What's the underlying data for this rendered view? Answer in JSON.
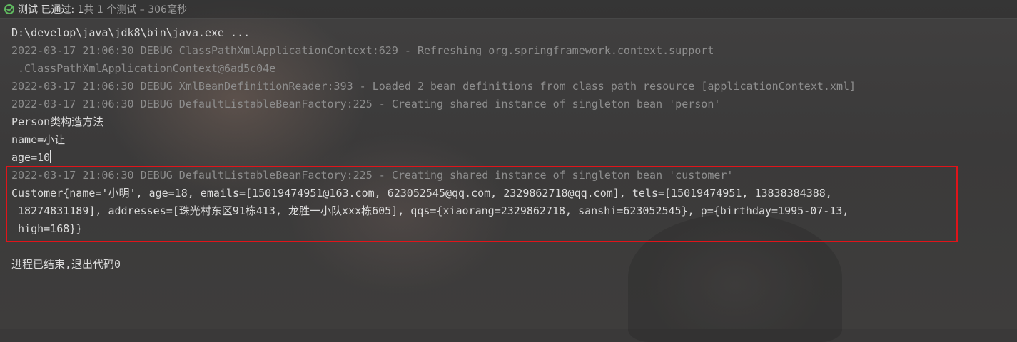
{
  "status": {
    "main": "测试 已通过: 1",
    "sub": "共 1 个测试 – 306毫秒",
    "check_color": "#5fb85f",
    "icon": "check-circle-icon"
  },
  "console": {
    "lines": [
      "D:\\develop\\java\\jdk8\\bin\\java.exe ...",
      "2022-03-17 21:06:30 DEBUG ClassPathXmlApplicationContext:629 - Refreshing org.springframework.context.support",
      " .ClassPathXmlApplicationContext@6ad5c04e",
      "2022-03-17 21:06:30 DEBUG XmlBeanDefinitionReader:393 - Loaded 2 bean definitions from class path resource [applicationContext.xml]",
      "2022-03-17 21:06:30 DEBUG DefaultListableBeanFactory:225 - Creating shared instance of singleton bean 'person'",
      "Person类构造方法",
      "name=小让",
      "age=10",
      "2022-03-17 21:06:30 DEBUG DefaultListableBeanFactory:225 - Creating shared instance of singleton bean 'customer'",
      "Customer{name='小明', age=18, emails=[15019474951@163.com, 623052545@qq.com, 2329862718@qq.com], tels=[15019474951, 13838384388,",
      " 18274831189], addresses=[珠光村东区91栋413, 龙胜一小队xxx栋605], qqs={xiaorang=2329862718, sanshi=623052545}, p={birthday=1995-07-13,",
      " high=168}}",
      "",
      "进程已结束,退出代码0"
    ]
  },
  "highlight_color": "#e0141a"
}
